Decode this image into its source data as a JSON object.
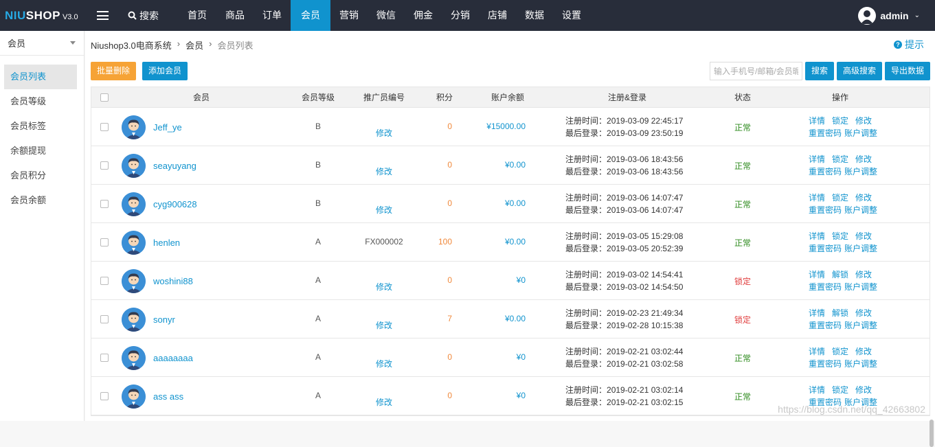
{
  "logo": {
    "part1": "NIU",
    "part2": "SHOP",
    "version": "V3.0"
  },
  "topbar": {
    "search_label": "搜索",
    "nav": [
      "首页",
      "商品",
      "订单",
      "会员",
      "营销",
      "微信",
      "佣金",
      "分销",
      "店铺",
      "数据",
      "设置"
    ],
    "active_nav": "会员",
    "user": "admin"
  },
  "sidebar": {
    "header": "会员",
    "items": [
      "会员列表",
      "会员等级",
      "会员标签",
      "余额提现",
      "会员积分",
      "会员余额"
    ],
    "active": "会员列表"
  },
  "breadcrumb": [
    "Niushop3.0电商系统",
    "会员",
    "会员列表"
  ],
  "hint": "提示",
  "toolbar": {
    "batch_delete": "批量删除",
    "add_member": "添加会员",
    "search_placeholder": "输入手机号/邮箱/会员昵称",
    "search": "搜索",
    "advanced_search": "高级搜索",
    "export": "导出数据"
  },
  "table": {
    "headers": [
      "会员",
      "会员等级",
      "推广员编号",
      "积分",
      "账户余额",
      "注册&登录",
      "状态",
      "操作"
    ],
    "reg_prefix": "注册时间：",
    "login_prefix": "最后登录：",
    "rows": [
      {
        "name": "Jeff_ye",
        "level": "B",
        "ref": "修改",
        "ref_is_link": true,
        "points": "0",
        "balance": "¥15000.00",
        "reg": "2019-03-09 22:45:17",
        "login": "2019-03-09 23:50:19",
        "status": "正常",
        "locked": false,
        "ops1": [
          "详情",
          "锁定",
          "修改"
        ],
        "ops2": [
          "重置密码",
          "账户调整"
        ]
      },
      {
        "name": "seayuyang",
        "level": "B",
        "ref": "修改",
        "ref_is_link": true,
        "points": "0",
        "balance": "¥0.00",
        "reg": "2019-03-06 18:43:56",
        "login": "2019-03-06 18:43:56",
        "status": "正常",
        "locked": false,
        "ops1": [
          "详情",
          "锁定",
          "修改"
        ],
        "ops2": [
          "重置密码",
          "账户调整"
        ]
      },
      {
        "name": "cyg900628",
        "level": "B",
        "ref": "修改",
        "ref_is_link": true,
        "points": "0",
        "balance": "¥0.00",
        "reg": "2019-03-06 14:07:47",
        "login": "2019-03-06 14:07:47",
        "status": "正常",
        "locked": false,
        "ops1": [
          "详情",
          "锁定",
          "修改"
        ],
        "ops2": [
          "重置密码",
          "账户调整"
        ]
      },
      {
        "name": "henlen",
        "level": "A",
        "ref": "FX000002",
        "ref_is_link": false,
        "points": "100",
        "balance": "¥0.00",
        "reg": "2019-03-05 15:29:08",
        "login": "2019-03-05 20:52:39",
        "status": "正常",
        "locked": false,
        "ops1": [
          "详情",
          "锁定",
          "修改"
        ],
        "ops2": [
          "重置密码",
          "账户调整"
        ]
      },
      {
        "name": "woshini88",
        "level": "A",
        "ref": "修改",
        "ref_is_link": true,
        "points": "0",
        "balance": "¥0",
        "reg": "2019-03-02 14:54:41",
        "login": "2019-03-02 14:54:50",
        "status": "锁定",
        "locked": true,
        "ops1": [
          "详情",
          "解锁",
          "修改"
        ],
        "ops2": [
          "重置密码",
          "账户调整"
        ]
      },
      {
        "name": "sonyr",
        "level": "A",
        "ref": "修改",
        "ref_is_link": true,
        "points": "7",
        "balance": "¥0.00",
        "reg": "2019-02-23 21:49:34",
        "login": "2019-02-28 10:15:38",
        "status": "锁定",
        "locked": true,
        "ops1": [
          "详情",
          "解锁",
          "修改"
        ],
        "ops2": [
          "重置密码",
          "账户调整"
        ]
      },
      {
        "name": "aaaaaaaa",
        "level": "A",
        "ref": "修改",
        "ref_is_link": true,
        "points": "0",
        "balance": "¥0",
        "reg": "2019-02-21 03:02:44",
        "login": "2019-02-21 03:02:58",
        "status": "正常",
        "locked": false,
        "ops1": [
          "详情",
          "锁定",
          "修改"
        ],
        "ops2": [
          "重置密码",
          "账户调整"
        ]
      },
      {
        "name": "ass ass",
        "level": "A",
        "ref": "修改",
        "ref_is_link": true,
        "points": "0",
        "balance": "¥0",
        "reg": "2019-02-21 03:02:14",
        "login": "2019-02-21 03:02:15",
        "status": "正常",
        "locked": false,
        "ops1": [
          "详情",
          "锁定",
          "修改"
        ],
        "ops2": [
          "重置密码",
          "账户调整"
        ]
      }
    ]
  },
  "watermark": "https://blog.csdn.net/qq_42663802",
  "colors": {
    "topbar": "#282d3a",
    "accent": "#1093ce",
    "orange": "#f6a336",
    "ok": "#2e8b1e",
    "locked": "#e03c3c"
  }
}
